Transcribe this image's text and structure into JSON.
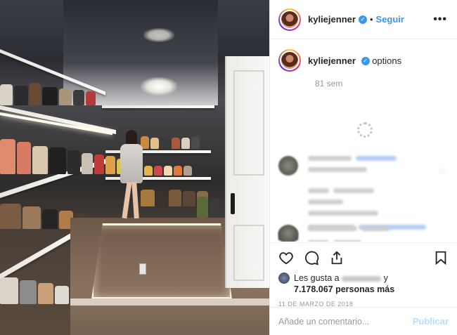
{
  "post": {
    "username": "kyliejenner",
    "follow_label": "Seguir",
    "separator": "•",
    "more_label": "•••"
  },
  "caption": {
    "username": "kyliejenner",
    "text": "options",
    "time": "81 sem"
  },
  "likes": {
    "prefix": "Les gusta a",
    "connector": "y",
    "count_text": "7.178.067 personas más"
  },
  "date": "11 DE MARZO DE 2018",
  "comment_box": {
    "placeholder": "Añade un comentario...",
    "publish_label": "Publicar"
  },
  "icons": [
    "heart-icon",
    "comment-icon",
    "share-icon",
    "bookmark-icon",
    "verified-icon",
    "more-options-icon"
  ],
  "colors": {
    "accent": "#3897f0",
    "publish_disabled": "#b2dffc",
    "text": "#262626",
    "muted": "#999999"
  }
}
